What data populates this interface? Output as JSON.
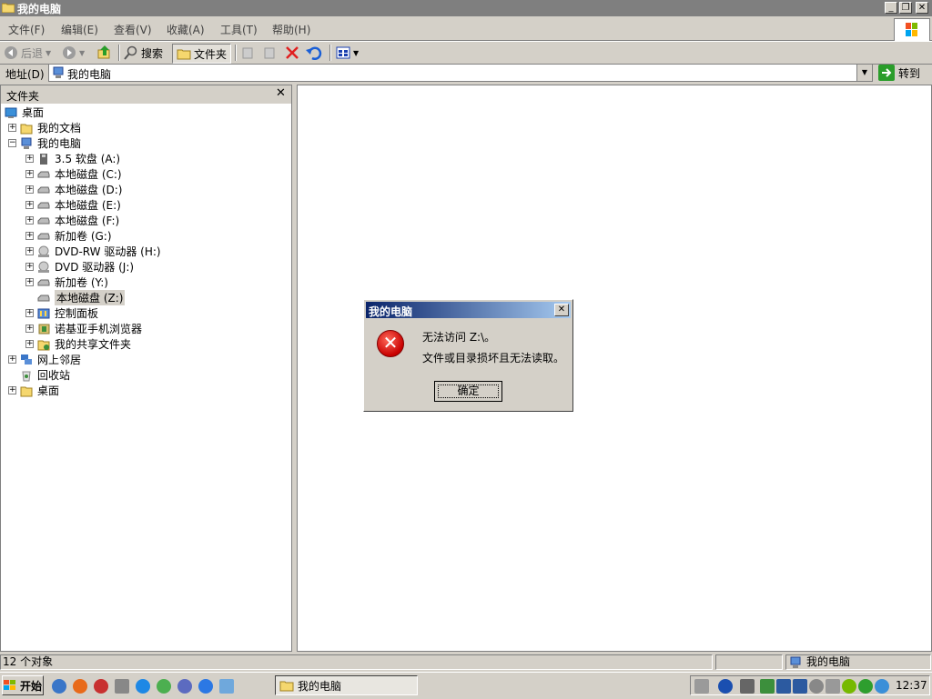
{
  "window": {
    "title": "我的电脑"
  },
  "menu": [
    "文件(F)",
    "编辑(E)",
    "查看(V)",
    "收藏(A)",
    "工具(T)",
    "帮助(H)"
  ],
  "toolbar": {
    "back": "后退",
    "search": "搜索",
    "folders": "文件夹"
  },
  "address": {
    "label": "地址(D)",
    "value": "我的电脑",
    "go": "转到"
  },
  "folders_pane": {
    "title": "文件夹",
    "items": [
      {
        "label": "桌面",
        "level": 0,
        "expander": "",
        "icon": "desktop-icon"
      },
      {
        "label": "我的文档",
        "level": 1,
        "expander": "+",
        "icon": "folder-icon"
      },
      {
        "label": "我的电脑",
        "level": 1,
        "expander": "−",
        "icon": "computer-icon"
      },
      {
        "label": "3.5 软盘 (A:)",
        "level": 2,
        "expander": "+",
        "icon": "floppy-icon"
      },
      {
        "label": "本地磁盘 (C:)",
        "level": 2,
        "expander": "+",
        "icon": "drive-icon"
      },
      {
        "label": "本地磁盘 (D:)",
        "level": 2,
        "expander": "+",
        "icon": "drive-icon"
      },
      {
        "label": "本地磁盘 (E:)",
        "level": 2,
        "expander": "+",
        "icon": "drive-icon"
      },
      {
        "label": "本地磁盘 (F:)",
        "level": 2,
        "expander": "+",
        "icon": "drive-icon"
      },
      {
        "label": "新加卷 (G:)",
        "level": 2,
        "expander": "+",
        "icon": "drive-icon"
      },
      {
        "label": "DVD-RW 驱动器 (H:)",
        "level": 2,
        "expander": "+",
        "icon": "dvd-icon"
      },
      {
        "label": "DVD 驱动器 (J:)",
        "level": 2,
        "expander": "+",
        "icon": "dvd-icon"
      },
      {
        "label": "新加卷 (Y:)",
        "level": 2,
        "expander": "+",
        "icon": "drive-icon"
      },
      {
        "label": "本地磁盘 (Z:)",
        "level": 2,
        "expander": "",
        "icon": "drive-icon",
        "selected": true
      },
      {
        "label": "控制面板",
        "level": 2,
        "expander": "+",
        "icon": "control-panel-icon"
      },
      {
        "label": "诺基亚手机浏览器",
        "level": 2,
        "expander": "+",
        "icon": "phone-icon"
      },
      {
        "label": "我的共享文件夹",
        "level": 2,
        "expander": "+",
        "icon": "shared-folder-icon"
      },
      {
        "label": "网上邻居",
        "level": 1,
        "expander": "+",
        "icon": "network-icon"
      },
      {
        "label": "回收站",
        "level": 1,
        "expander": "",
        "icon": "recycle-bin-icon"
      },
      {
        "label": "桌面",
        "level": 1,
        "expander": "+",
        "icon": "folder-icon"
      }
    ]
  },
  "status": {
    "count": "12 个对象",
    "location": "我的电脑"
  },
  "taskbar": {
    "start": "开始",
    "task": "我的电脑",
    "clock": "12:37"
  },
  "dialog": {
    "title": "我的电脑",
    "line1": "无法访问 Z:\\。",
    "line2": "文件或目录损坏且无法读取。",
    "ok": "确定"
  },
  "colors": {
    "error": "#c80000",
    "dialog_title": "#0a246a"
  }
}
